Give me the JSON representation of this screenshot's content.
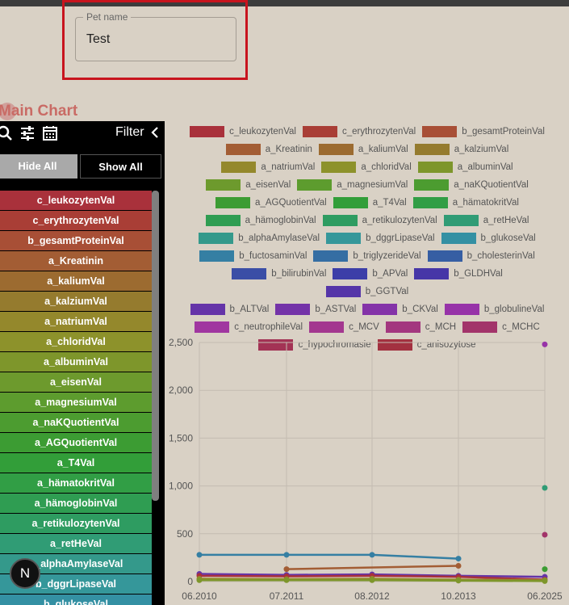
{
  "form": {
    "pet_name_label": "Pet name",
    "pet_name_value": "Test"
  },
  "main_title": "Main Chart",
  "panel": {
    "filter_label": "Filter",
    "hide_all_label": "Hide All",
    "show_all_label": "Show All",
    "icons": [
      "search-icon",
      "tune-icon",
      "calendar-icon",
      "chevron-left-icon"
    ]
  },
  "series_items": [
    {
      "label": "c_leukozytenVal",
      "color": "#a9313b"
    },
    {
      "label": "c_erythrozytenVal",
      "color": "#a93e36"
    },
    {
      "label": "b_gesamtProteinVal",
      "color": "#a84f36"
    },
    {
      "label": "a_Kreatinin",
      "color": "#a35d34"
    },
    {
      "label": "a_kaliumVal",
      "color": "#9c6b30"
    },
    {
      "label": "a_kalziumVal",
      "color": "#957b2e"
    },
    {
      "label": "a_natriumVal",
      "color": "#94882c"
    },
    {
      "label": "a_chloridVal",
      "color": "#8d922b"
    },
    {
      "label": "a_albuminVal",
      "color": "#7e962b"
    },
    {
      "label": "a_eisenVal",
      "color": "#6d9a2d"
    },
    {
      "label": "a_magnesiumVal",
      "color": "#5d9c2e"
    },
    {
      "label": "a_naKQuotientVal",
      "color": "#4c9c30"
    },
    {
      "label": "a_AGQuotientVal",
      "color": "#3c9c33"
    },
    {
      "label": "a_T4Val",
      "color": "#329e39"
    },
    {
      "label": "a_hämatokritVal",
      "color": "#319e45"
    },
    {
      "label": "a_hämoglobinVal",
      "color": "#2f9d52"
    },
    {
      "label": "a_retikulozytenVal",
      "color": "#2e9c61"
    },
    {
      "label": "a_retHeVal",
      "color": "#309c75"
    },
    {
      "label": "b_alphaAmylaseVal",
      "color": "#34998b"
    },
    {
      "label": "b_dggrLipaseVal",
      "color": "#35979a"
    },
    {
      "label": "b_glukoseVal",
      "color": "#3490a3"
    }
  ],
  "n_badge": "N",
  "legend_rows": [
    [
      {
        "label": "c_leukozytenVal",
        "color": "#a9313b"
      },
      {
        "label": "c_erythrozytenVal",
        "color": "#a93e36"
      },
      {
        "label": "b_gesamtProteinVal",
        "color": "#a84f36"
      }
    ],
    [
      {
        "label": "a_Kreatinin",
        "color": "#a35d34"
      },
      {
        "label": "a_kaliumVal",
        "color": "#9c6b30"
      },
      {
        "label": "a_kalziumVal",
        "color": "#957b2e"
      }
    ],
    [
      {
        "label": "a_natriumVal",
        "color": "#94882c"
      },
      {
        "label": "a_chloridVal",
        "color": "#8d922b"
      },
      {
        "label": "a_albuminVal",
        "color": "#7e962b"
      }
    ],
    [
      {
        "label": "a_eisenVal",
        "color": "#6d9a2d"
      },
      {
        "label": "a_magnesiumVal",
        "color": "#5d9c2e"
      },
      {
        "label": "a_naKQuotientVal",
        "color": "#4c9c30"
      }
    ],
    [
      {
        "label": "a_AGQuotientVal",
        "color": "#3c9c33"
      },
      {
        "label": "a_T4Val",
        "color": "#329e39"
      },
      {
        "label": "a_hämatokritVal",
        "color": "#319e45"
      }
    ],
    [
      {
        "label": "a_hämoglobinVal",
        "color": "#2f9d52"
      },
      {
        "label": "a_retikulozytenVal",
        "color": "#2e9c61"
      },
      {
        "label": "a_retHeVal",
        "color": "#309c75"
      }
    ],
    [
      {
        "label": "b_alphaAmylaseVal",
        "color": "#34998b"
      },
      {
        "label": "b_dggrLipaseVal",
        "color": "#35979a"
      },
      {
        "label": "b_glukoseVal",
        "color": "#3490a3"
      }
    ],
    [
      {
        "label": "b_fuctosaminVal",
        "color": "#357fa3"
      },
      {
        "label": "b_triglyzerideVal",
        "color": "#356ea3"
      },
      {
        "label": "b_cholesterinVal",
        "color": "#365ea3"
      }
    ],
    [
      {
        "label": "b_bilirubinVal",
        "color": "#3a4ea6"
      },
      {
        "label": "b_APVal",
        "color": "#3c3ea8"
      },
      {
        "label": "b_GLDHVal",
        "color": "#4636a7"
      }
    ],
    [
      {
        "label": "b_GGTVal",
        "color": "#5535a8"
      }
    ],
    [
      {
        "label": "b_ALTVal",
        "color": "#6534a8"
      },
      {
        "label": "b_ASTVal",
        "color": "#7433a8"
      },
      {
        "label": "b_CKVal",
        "color": "#8433a8"
      },
      {
        "label": "b_globulineVal",
        "color": "#9733a8"
      }
    ],
    [
      {
        "label": "c_neutrophileVal",
        "color": "#a036a0"
      },
      {
        "label": "c_MCV",
        "color": "#a3378f"
      },
      {
        "label": "c_MCH",
        "color": "#a3377f"
      },
      {
        "label": "c_MCHC",
        "color": "#a2346a"
      }
    ],
    [
      {
        "label": "c_hypochromasie",
        "color": "#a33355"
      },
      {
        "label": "c_anisozytose",
        "color": "#a33140"
      }
    ]
  ],
  "chart_data": {
    "type": "line",
    "x_ticks": [
      "06.2010",
      "07.2011",
      "08.2012",
      "10.2013",
      "06.2025"
    ],
    "y_ticks": [
      "0",
      "500",
      "1,000",
      "1,500",
      "2,000",
      "2,500"
    ],
    "ylim": [
      0,
      2500
    ],
    "grid": true,
    "series": [
      {
        "name": "b_fuctosaminVal",
        "color": "#357fa3",
        "values": [
          280,
          280,
          280,
          240,
          null
        ]
      },
      {
        "name": "a_Kreatinin",
        "color": "#a35d34",
        "values": [
          null,
          130,
          null,
          165,
          null
        ]
      },
      {
        "name": "b_ALTVal",
        "color": "#6534a8",
        "values": [
          80,
          70,
          75,
          60,
          50
        ]
      },
      {
        "name": "c_leukozytenVal",
        "color": "#a9313b",
        "values": [
          60,
          55,
          60,
          50,
          20
        ]
      },
      {
        "name": "a_natriumVal",
        "color": "#94882c",
        "values": [
          30,
          25,
          30,
          20,
          15
        ]
      },
      {
        "name": "a_albuminVal",
        "color": "#7e962b",
        "values": [
          15,
          15,
          15,
          10,
          5
        ]
      },
      {
        "name": "b_globulineVal",
        "color": "#9733a8",
        "values": [
          null,
          null,
          null,
          null,
          2480
        ]
      },
      {
        "name": "a_retHeVal",
        "color": "#309c75",
        "values": [
          null,
          null,
          null,
          null,
          980
        ]
      },
      {
        "name": "c_MCHC",
        "color": "#a2346a",
        "values": [
          null,
          null,
          null,
          null,
          490
        ]
      },
      {
        "name": "a_AGQuotientVal",
        "color": "#3c9c33",
        "values": [
          null,
          null,
          null,
          null,
          130
        ]
      }
    ]
  }
}
